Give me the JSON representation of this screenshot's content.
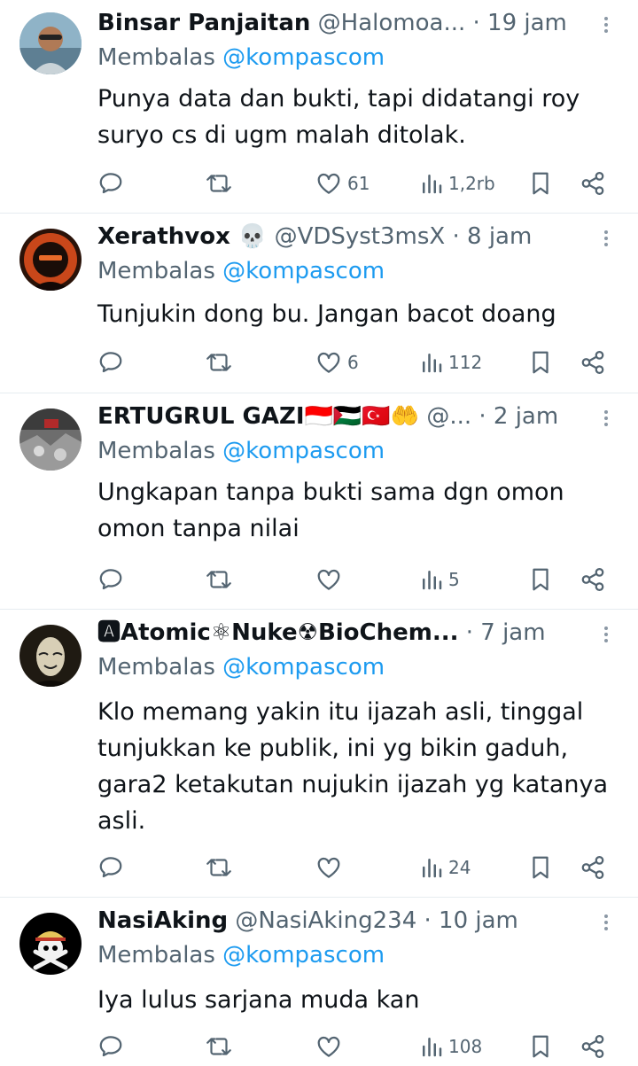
{
  "tweets": [
    {
      "name": "Binsar Panjaitan",
      "handle": "@Halomoa...",
      "time": "· 19 jam",
      "reply_label": "Membalas",
      "reply_to": "@kompascom",
      "text_lines": [
        "Punya data dan bukti, tapi didatangi roy",
        "suryo cs di ugm malah ditolak."
      ],
      "likes": "61",
      "views": "1,2rb"
    },
    {
      "name": "Xerathvox 💀",
      "handle": "@VDSyst3msX",
      "time": "· 8 jam",
      "reply_label": "Membalas",
      "reply_to": "@kompascom",
      "text_lines": [
        "Tunjukin dong bu. Jangan bacot doang"
      ],
      "likes": "6",
      "views": "112"
    },
    {
      "name": "ERTUGRUL GAZI🇮🇩🇵🇸🇹🇷🤲",
      "handle": "@...",
      "time": "· 2 jam",
      "reply_label": "Membalas",
      "reply_to": "@kompascom",
      "text_lines": [
        "Ungkapan tanpa bukti sama dgn omon",
        "omon tanpa nilai"
      ],
      "likes": "",
      "views": "5"
    },
    {
      "name": "🅰Atomic⚛Nuke☢BioChem...",
      "handle": "",
      "time": "· 7 jam",
      "reply_label": "Membalas",
      "reply_to": "@kompascom",
      "text_lines": [
        "Klo memang yakin itu ijazah asli, tinggal",
        "tunjukkan ke publik, ini yg bikin gaduh,",
        "gara2 ketakutan nujukin ijazah yg katanya",
        "asli."
      ],
      "likes": "",
      "views": "24"
    },
    {
      "name": "NasiAking",
      "handle": "@NasiAking234",
      "time": "· 10 jam",
      "reply_label": "Membalas",
      "reply_to": "@kompascom",
      "text_lines": [
        "Iya lulus sarjana muda kan"
      ],
      "likes": "",
      "views": "108"
    }
  ],
  "icons": {
    "reply": "reply-icon",
    "retweet": "retweet-icon",
    "like": "heart-icon",
    "views": "views-icon",
    "bookmark": "bookmark-icon",
    "share": "share-icon",
    "more": "more-icon"
  },
  "colors": {
    "text": "#0f1419",
    "secondary": "#536471",
    "mention": "#1d9bf0",
    "divider": "#e6ecf0"
  }
}
